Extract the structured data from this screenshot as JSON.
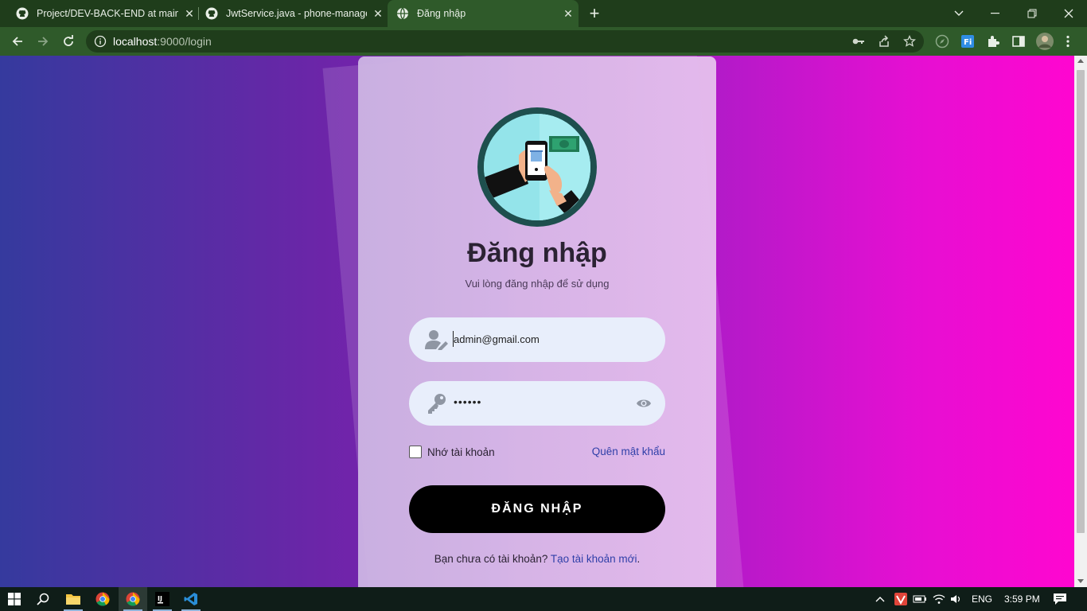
{
  "browser": {
    "tabs": [
      {
        "title": "Project/DEV-BACK-END at main ·",
        "favicon": "github-icon"
      },
      {
        "title": "JwtService.java - phone-manager",
        "favicon": "github-icon"
      },
      {
        "title": "Đăng nhập",
        "favicon": "globe-icon",
        "active": true
      }
    ],
    "new_tab": "+",
    "url_host": "localhost",
    "url_rest": ":9000/login"
  },
  "login": {
    "title": "Đăng nhập",
    "subtitle": "Vui lòng đăng nhập để sử dụng",
    "email_value": "admin@gmail.com",
    "password_value": "••••••",
    "remember_label": "Nhớ tài khoản",
    "forgot_label": "Quên mật khẩu",
    "submit_label": "ĐĂNG NHẬP",
    "signup_prompt": "Bạn chưa có tài khoản?",
    "signup_link": "Tạo tài khoản mới",
    "signup_end": "."
  },
  "taskbar": {
    "language": "ENG",
    "time": "3:59 PM"
  },
  "colors": {
    "gradient_start": "#353a9e",
    "gradient_end": "#ff06d0",
    "browser_frame": "#2f5a2a",
    "button": "#000000",
    "link": "#2f3fa8"
  }
}
